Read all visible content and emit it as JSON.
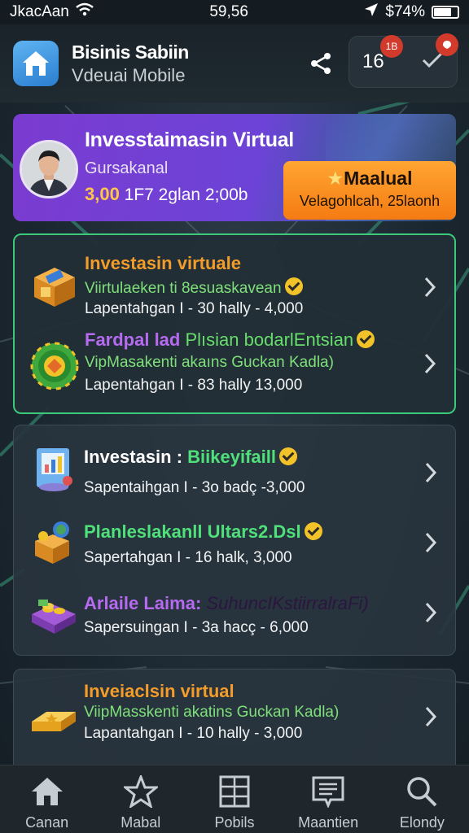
{
  "status_bar": {
    "carrier": "JkacAan",
    "time": "59,56",
    "battery": "$74%"
  },
  "header": {
    "title": "Bisinis Sabiin",
    "subtitle": "Vdeuai Mobile",
    "count": "16",
    "count_badge": "1B"
  },
  "promo": {
    "title": "Invesstaimasin Virtual",
    "subtitle": "Gursakanal",
    "price_value": "3,00",
    "price_rest": " 1F7 2glan 2;00b",
    "button_title": "Maalual",
    "button_sub": "Velagohlcah, 25laonh"
  },
  "list1": [
    {
      "title": "Investasin virtuale",
      "line2": "Viirtulaeken ti 8esuaskavean",
      "line3": "Lapentahgan I - 30 hally - 4,000"
    },
    {
      "title": "Fardpal lad",
      "title_extra": "Plısian bodarlEntsian",
      "line2": "VipMasakenti akaıns Guckan Kadla)",
      "line3": "Lapentahgan I - 83 hally 13,000"
    }
  ],
  "list2": [
    {
      "title": "Investasin :",
      "title_extra": "Biikeyifaill",
      "line3": "Sapentaihgan I - 3o badç -3,000"
    },
    {
      "title": "Planleslakanll Ultars2.Dsl",
      "line3": "Sapertahgan I - 16 halk, 3,000"
    },
    {
      "title": "Arlaile Laima:",
      "title_extra": "SuhuncIKstiirralraFi)",
      "line3": "Sapersuingan I - 3a hacç - 6,000"
    }
  ],
  "list3": [
    {
      "title": "Inveiaclsin virtual",
      "line2": "ViipMasskenti akatins Guckan Kadla)",
      "line3": "Lapantahgan I - 10 hally - 3,000"
    }
  ],
  "bottom_nav": [
    {
      "label": "Canan",
      "icon": "home-icon"
    },
    {
      "label": "Mabal",
      "icon": "star-icon"
    },
    {
      "label": "Pobils",
      "icon": "grid-icon"
    },
    {
      "label": "Maantien",
      "icon": "message-icon"
    },
    {
      "label": "Elondy",
      "icon": "search-icon"
    }
  ],
  "colors": {
    "accent_green": "#3bc97a",
    "promo_purple": "#7b3bd0",
    "button_orange": "#f57b12",
    "check_yellow": "#f2c229"
  }
}
